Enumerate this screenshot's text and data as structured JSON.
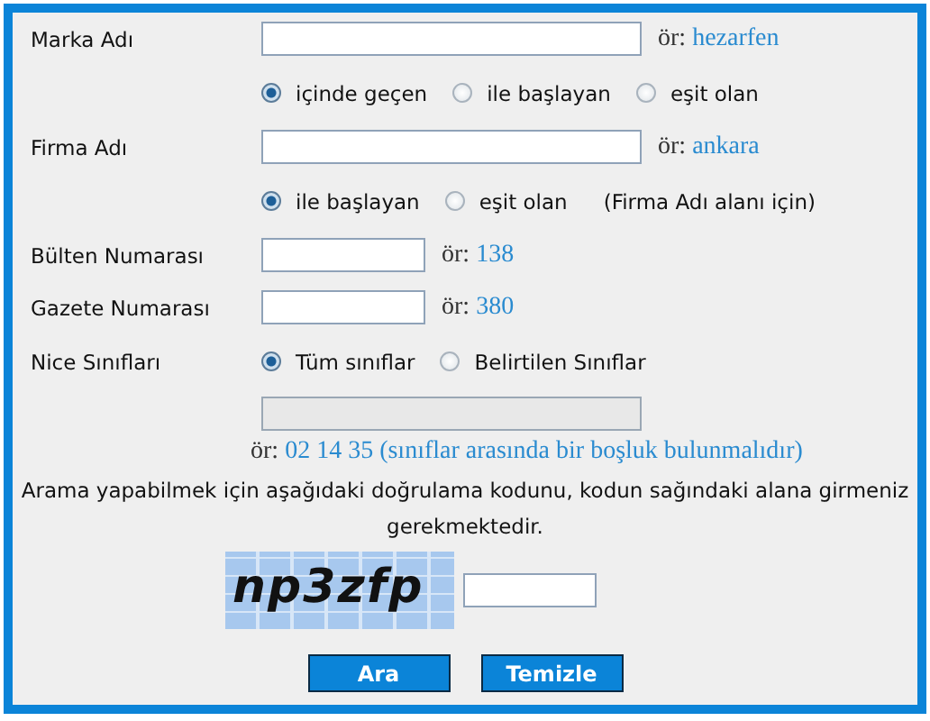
{
  "rows": [
    {
      "kind": "long-field",
      "label": "Marka Adı",
      "hint_prefix": "ör:",
      "hint": "hezarfen"
    },
    {
      "kind": "radios",
      "options": [
        {
          "label": "içinde geçen",
          "selected": true
        },
        {
          "label": "ile başlayan",
          "selected": false
        },
        {
          "label": "eşit olan",
          "selected": false
        }
      ]
    },
    {
      "kind": "long-field",
      "label": "Firma Adı",
      "hint_prefix": "ör:",
      "hint": "ankara"
    },
    {
      "kind": "radios",
      "options": [
        {
          "label": "ile başlayan",
          "selected": true
        },
        {
          "label": "eşit olan",
          "selected": false
        }
      ],
      "note": "(Firma Adı alanı için)"
    },
    {
      "kind": "short-field",
      "label": "Bülten Numarası",
      "hint_prefix": "ör:",
      "hint": "138"
    },
    {
      "kind": "short-field",
      "label": "Gazete Numarası",
      "hint_prefix": "ör:",
      "hint": "380"
    },
    {
      "kind": "radios",
      "label": "Nice Sınıfları",
      "options": [
        {
          "label": "Tüm sınıflar",
          "selected": true
        },
        {
          "label": "Belirtilen Sınıflar",
          "selected": false
        }
      ]
    },
    {
      "kind": "long-field",
      "disabled": true
    },
    {
      "kind": "example",
      "hint_prefix": "ör:",
      "hint": "02 14 35 (sınıflar arasında bir boşluk bulunmalıdır)"
    }
  ],
  "instruction": "Arama yapabilmek için aşağıdaki doğrulama kodunu, kodun sağındaki alana girmeniz gerekmektedir.",
  "captcha": {
    "code": "np3zfp"
  },
  "buttons": [
    "Ara",
    "Temizle"
  ]
}
